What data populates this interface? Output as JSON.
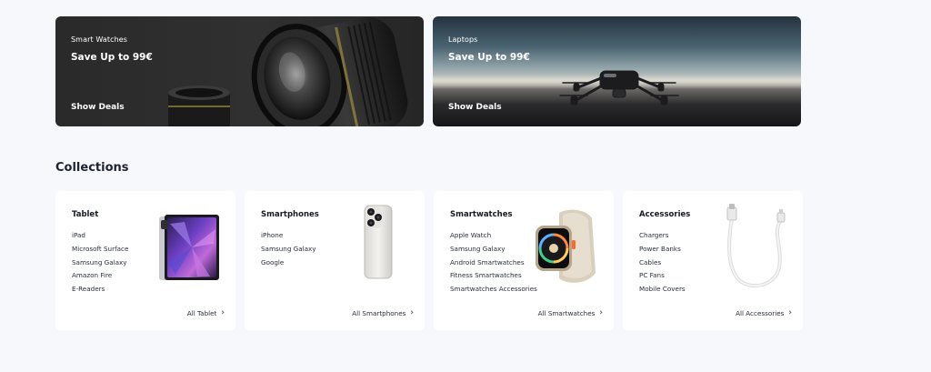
{
  "promos": [
    {
      "category": "Smart Watches",
      "title": "Save Up to 99€",
      "cta": "Show Deals",
      "art": "camera-lens-image"
    },
    {
      "category": "Laptops",
      "title": "Save Up to 99€",
      "cta": "Show Deals",
      "art": "drone-image"
    }
  ],
  "collections": {
    "title": "Collections",
    "cards": [
      {
        "title": "Tablet",
        "items": [
          "iPad",
          "Microsoft Surface",
          "Samsung Galaxy",
          "Amazon Fire",
          "E-Readers"
        ],
        "link": "All Tablet",
        "image": "tablet-image"
      },
      {
        "title": "Smartphones",
        "items": [
          "iPhone",
          "Samsung Galaxy",
          "Google"
        ],
        "link": "All Smartphones",
        "image": "smartphone-image"
      },
      {
        "title": "Smartwatches",
        "items": [
          "Apple Watch",
          "Samsung Galaxy",
          "Android Smartwatches",
          "Fitness Smartwatches",
          "Smartwatches Accessories"
        ],
        "link": "All Smartwatches",
        "image": "smartwatch-image"
      },
      {
        "title": "Accessories",
        "items": [
          "Chargers",
          "Power Banks",
          "Cables",
          "PC Fans",
          "Mobile Covers"
        ],
        "link": "All Accessories",
        "image": "cable-image"
      }
    ]
  },
  "icons": {
    "link_chevron": "chevron-right-icon"
  },
  "colors": {
    "page_bg": "#f6f8fb",
    "card_bg": "#ffffff",
    "promo_dark": "#2d2d2d",
    "text": "#1b1f2a"
  }
}
